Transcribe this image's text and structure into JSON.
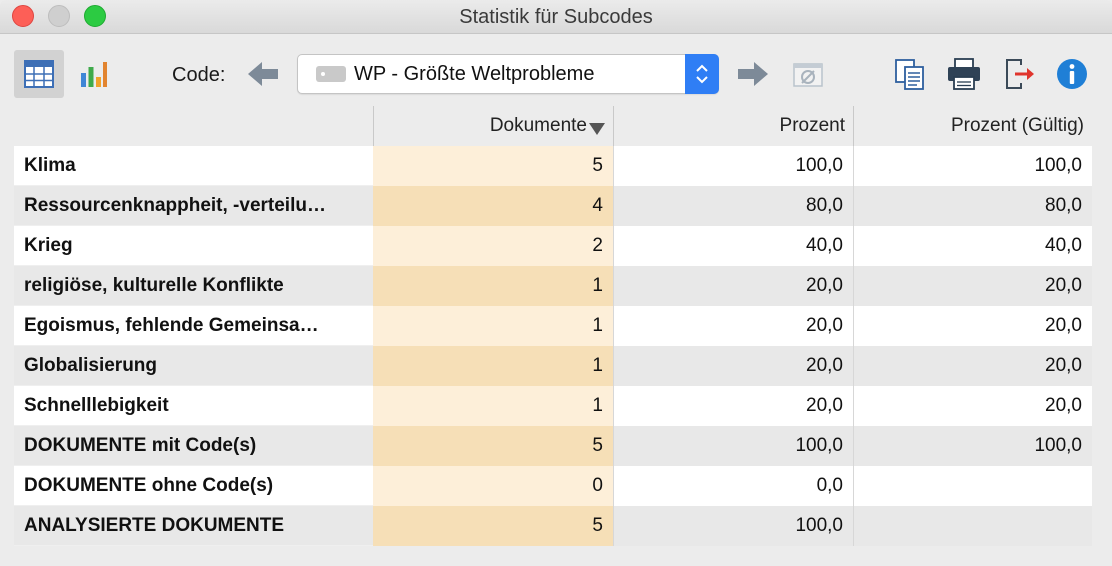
{
  "window": {
    "title": "Statistik für Subcodes"
  },
  "toolbar": {
    "code_label": "Code:",
    "selected_code": "WP - Größte Weltprobleme"
  },
  "table": {
    "columns": [
      "",
      "Dokumente",
      "Prozent",
      "Prozent (Gültig)"
    ],
    "rows": [
      {
        "name": "Klima",
        "docs": "5",
        "pct": "100,0",
        "valid": "100,0"
      },
      {
        "name": "Ressourcenknappheit, -verteilu…",
        "docs": "4",
        "pct": "80,0",
        "valid": "80,0"
      },
      {
        "name": "Krieg",
        "docs": "2",
        "pct": "40,0",
        "valid": "40,0"
      },
      {
        "name": "religiöse, kulturelle Konflikte",
        "docs": "1",
        "pct": "20,0",
        "valid": "20,0"
      },
      {
        "name": "Egoismus, fehlende Gemeinsa…",
        "docs": "1",
        "pct": "20,0",
        "valid": "20,0"
      },
      {
        "name": "Globalisierung",
        "docs": "1",
        "pct": "20,0",
        "valid": "20,0"
      },
      {
        "name": "Schnelllebigkeit",
        "docs": "1",
        "pct": "20,0",
        "valid": "20,0"
      },
      {
        "name": "DOKUMENTE mit Code(s)",
        "docs": "5",
        "pct": "100,0",
        "valid": "100,0"
      },
      {
        "name": "DOKUMENTE ohne Code(s)",
        "docs": "0",
        "pct": "0,0",
        "valid": ""
      },
      {
        "name": "ANALYSIERTE DOKUMENTE",
        "docs": "5",
        "pct": "100,0",
        "valid": ""
      }
    ]
  },
  "colors": {
    "docs_col_light": "#fdefd9",
    "docs_col_dark": "#f6dfb7",
    "stepper_blue": "#2f7ef5",
    "info_blue": "#1f7fd6",
    "export_red": "#e0342c"
  },
  "icons": [
    "table-view-icon",
    "chart-view-icon",
    "arrow-left-icon",
    "arrow-right-icon",
    "no-values-icon",
    "copy-icon",
    "print-icon",
    "export-icon",
    "info-icon"
  ]
}
